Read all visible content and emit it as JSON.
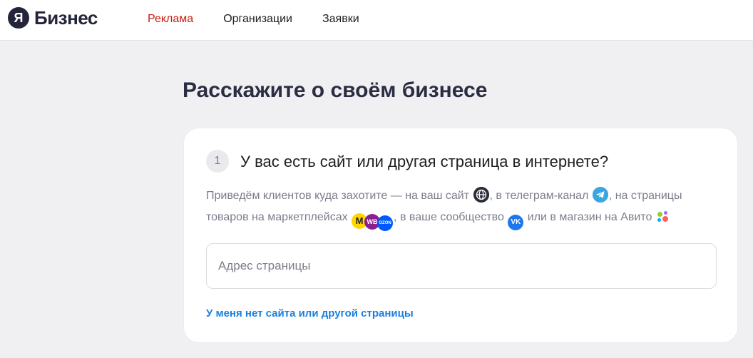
{
  "header": {
    "logo_mark": "Я",
    "logo_text": "Бизнес",
    "nav": [
      {
        "label": "Реклама",
        "active": true
      },
      {
        "label": "Организации",
        "active": false
      },
      {
        "label": "Заявки",
        "active": false
      }
    ]
  },
  "main": {
    "title": "Расскажите о своём бизнесе",
    "step": {
      "number": "1",
      "question": "У вас есть сайт или другая страница в интернете?",
      "desc": {
        "part1": "Приведём клиентов куда захотите — на ваш сайт",
        "part2": ", в телеграм-канал",
        "part3": ", на страницы товаров на маркетплейсах",
        "part4": ", в ваше сообщество",
        "part5": "или в магазин на Авито"
      },
      "icon_labels": {
        "yandex_market": "M",
        "wildberries": "WB",
        "ozon": "OZON",
        "vk": "VK"
      },
      "input_placeholder": "Адрес страницы",
      "no_site_link": "У меня нет сайта или другой страницы"
    }
  },
  "colors": {
    "accent_red": "#cc1a0f",
    "link_blue": "#1a7fde",
    "background": "#f0f0f2"
  }
}
